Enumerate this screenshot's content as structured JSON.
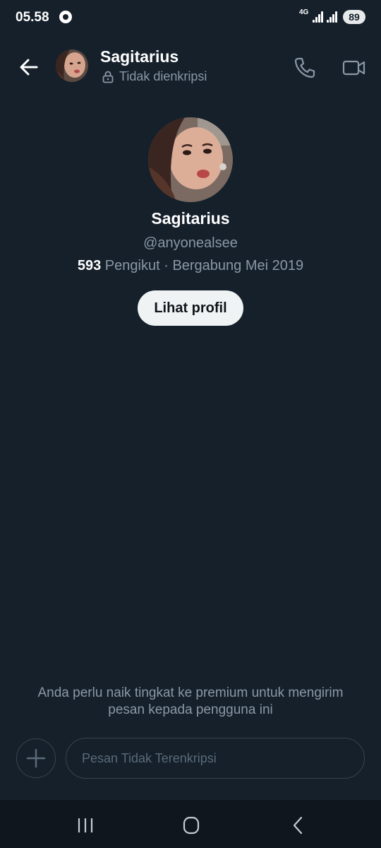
{
  "status_bar": {
    "time": "05.58",
    "network": "4G",
    "battery": "89"
  },
  "header": {
    "name": "Sagitarius",
    "encryption_status": "Tidak dienkripsi"
  },
  "profile": {
    "name": "Sagitarius",
    "handle": "@anyonealsee",
    "followers_count": "593",
    "followers_label": "Pengikut",
    "separator": "·",
    "joined": "Bergabung Mei 2019",
    "view_profile_label": "Lihat profil"
  },
  "notice": {
    "premium_message": "Anda perlu naik tingkat ke premium untuk mengirim pesan kepada pengguna ini"
  },
  "composer": {
    "placeholder": "Pesan Tidak Terenkripsi"
  },
  "icons": {
    "back": "arrow-left-icon",
    "lock": "lock-icon",
    "call": "phone-icon",
    "video": "video-camera-icon",
    "add": "plus-icon",
    "recents": "recents-icon",
    "home": "home-icon",
    "nav_back": "chevron-left-icon"
  },
  "colors": {
    "background": "#15202b",
    "primary_text": "#e7e9ea",
    "secondary_text": "#8b98a5",
    "button_bg": "#eff3f4",
    "border": "#38444d"
  }
}
